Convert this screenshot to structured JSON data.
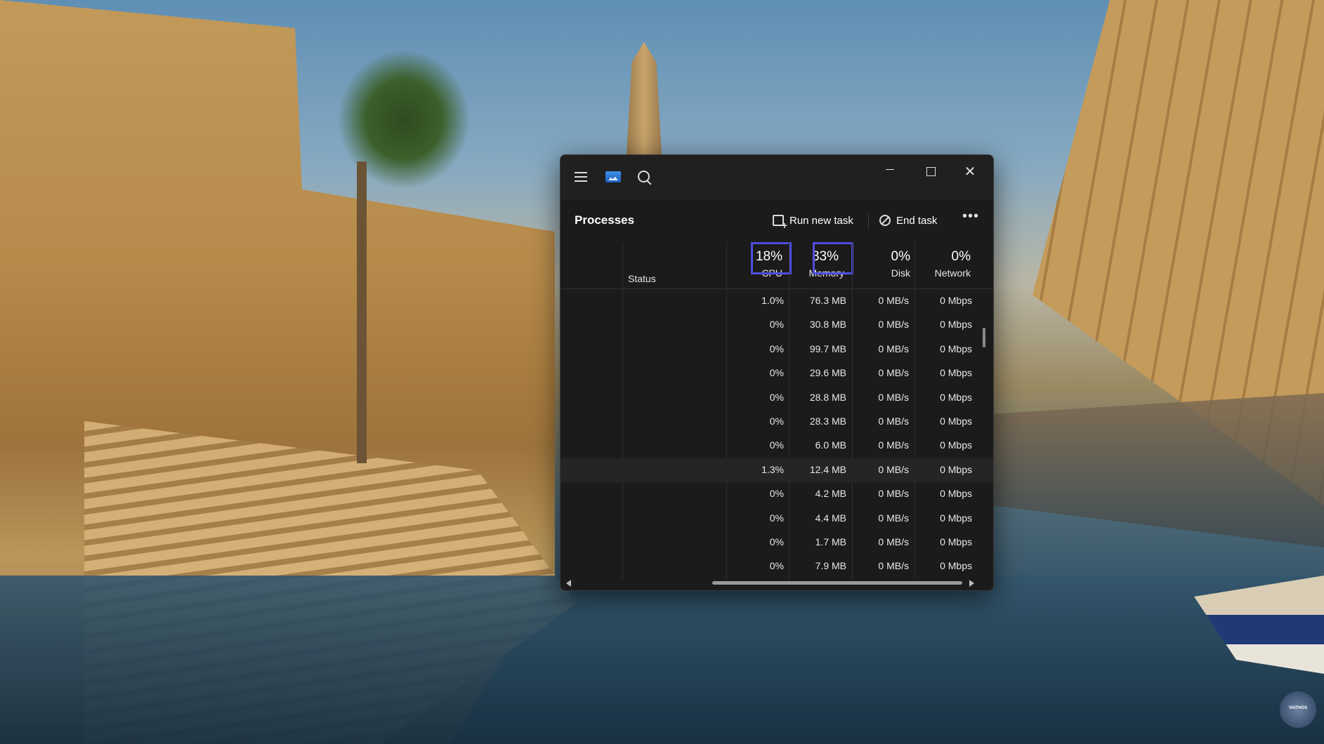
{
  "titlebar": {
    "menu_icon": "hamburger-menu-icon",
    "app_icon": "task-manager-icon",
    "search_icon": "search-icon",
    "minimize_icon": "minimize-icon",
    "maximize_icon": "maximize-icon",
    "close_glyph": "✕"
  },
  "toolbar": {
    "title": "Processes",
    "run_new_task": "Run new task",
    "end_task": "End task",
    "more": "•••"
  },
  "columns": {
    "status": "Status",
    "cpu": {
      "pct": "18%",
      "label": "CPU"
    },
    "memory": {
      "pct": "33%",
      "label": "Memory"
    },
    "disk": {
      "pct": "0%",
      "label": "Disk"
    },
    "network": {
      "pct": "0%",
      "label": "Network"
    }
  },
  "rows": [
    {
      "cpu": "1.0%",
      "memory": "76.3 MB",
      "disk": "0 MB/s",
      "network": "0 Mbps"
    },
    {
      "cpu": "0%",
      "memory": "30.8 MB",
      "disk": "0 MB/s",
      "network": "0 Mbps"
    },
    {
      "cpu": "0%",
      "memory": "99.7 MB",
      "disk": "0 MB/s",
      "network": "0 Mbps"
    },
    {
      "cpu": "0%",
      "memory": "29.6 MB",
      "disk": "0 MB/s",
      "network": "0 Mbps"
    },
    {
      "cpu": "0%",
      "memory": "28.8 MB",
      "disk": "0 MB/s",
      "network": "0 Mbps"
    },
    {
      "cpu": "0%",
      "memory": "28.3 MB",
      "disk": "0 MB/s",
      "network": "0 Mbps"
    },
    {
      "cpu": "0%",
      "memory": "6.0 MB",
      "disk": "0 MB/s",
      "network": "0 Mbps"
    },
    {
      "cpu": "1.3%",
      "memory": "12.4 MB",
      "disk": "0 MB/s",
      "network": "0 Mbps"
    },
    {
      "cpu": "0%",
      "memory": "4.2 MB",
      "disk": "0 MB/s",
      "network": "0 Mbps"
    },
    {
      "cpu": "0%",
      "memory": "4.4 MB",
      "disk": "0 MB/s",
      "network": "0 Mbps"
    },
    {
      "cpu": "0%",
      "memory": "1.7 MB",
      "disk": "0 MB/s",
      "network": "0 Mbps"
    },
    {
      "cpu": "0%",
      "memory": "7.9 MB",
      "disk": "0 MB/s",
      "network": "0 Mbps"
    }
  ],
  "highlight_color": "#4f4ee0",
  "watermark": "VIATHOS"
}
